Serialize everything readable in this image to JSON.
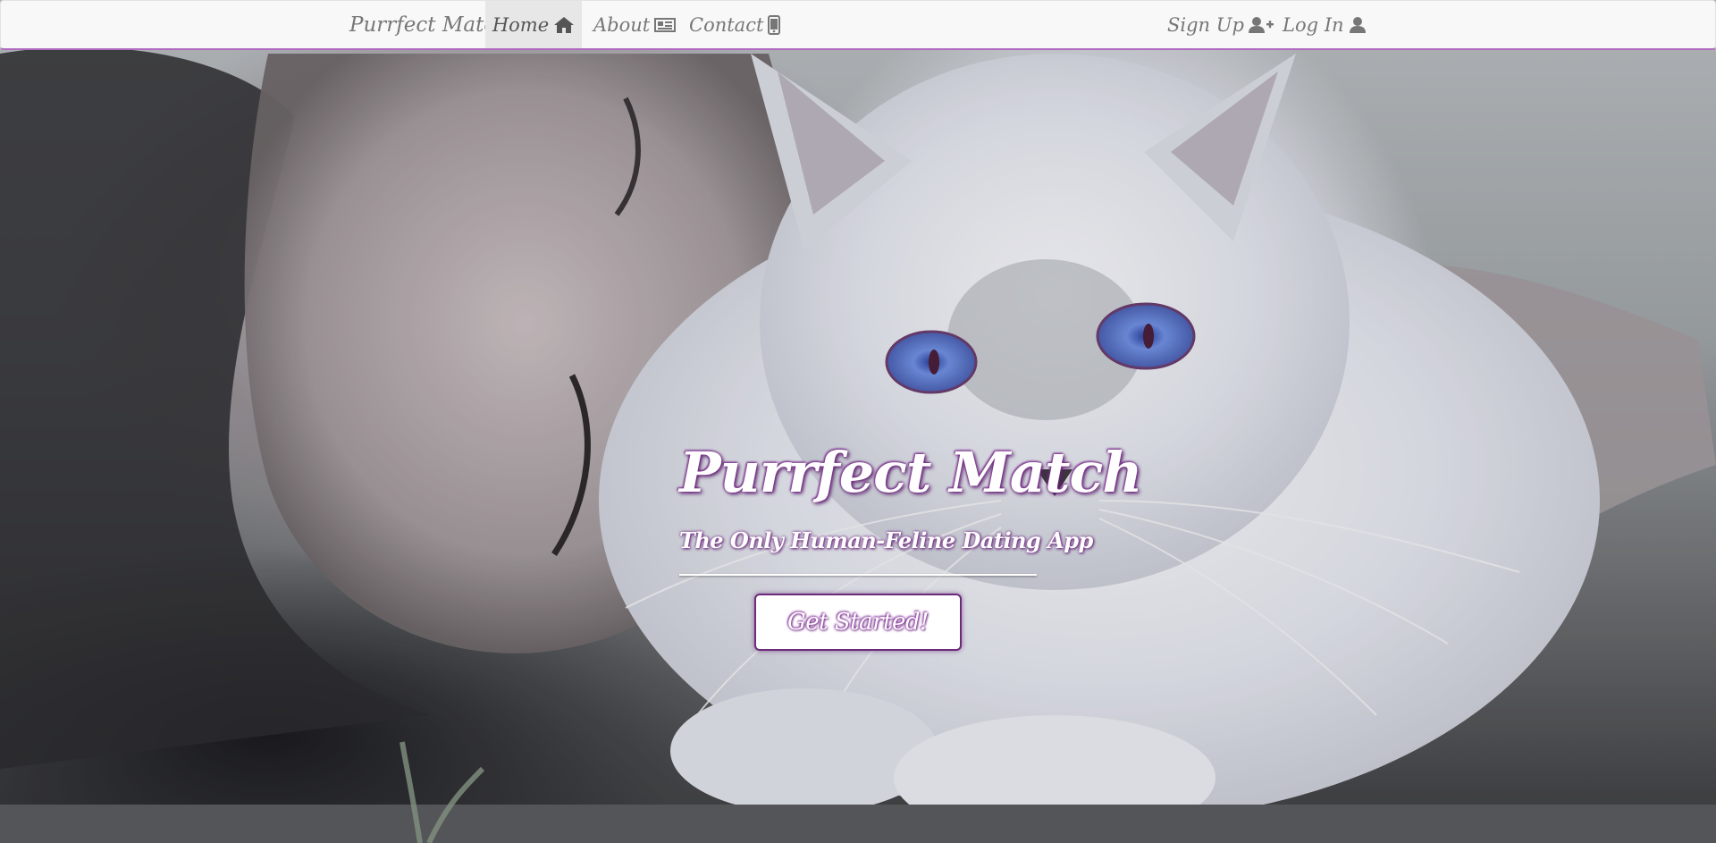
{
  "navbar": {
    "brand": "Purrfect Match",
    "links": [
      {
        "label": "Home",
        "icon": "home-icon",
        "active": true
      },
      {
        "label": "About",
        "icon": "newspaper-icon",
        "active": false
      },
      {
        "label": "Contact",
        "icon": "mobile-phone-icon",
        "active": false
      }
    ],
    "right_links": [
      {
        "label": "Sign Up",
        "icon": "user-plus-icon"
      },
      {
        "label": "Log In",
        "icon": "user-icon"
      }
    ]
  },
  "hero": {
    "title": "Purrfect Match",
    "subtitle": "The Only Human-Feline Dating App",
    "cta_label": "Get Started!",
    "background_image": "woman-with-white-blue-eyed-cat-photo"
  },
  "colors": {
    "accent": "#b06ac0",
    "accent_dark": "#6b2a7a",
    "navbar_bg": "#f8f8f8",
    "nav_text": "#777777",
    "active_bg": "#e7e7e7"
  }
}
